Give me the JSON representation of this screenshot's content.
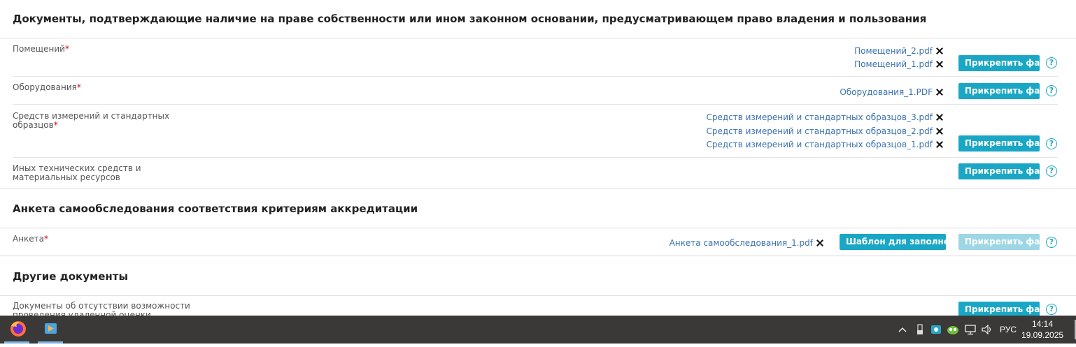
{
  "sections": [
    {
      "title": "Документы, подтверждающие наличие на праве собственности или ином законном основании, предусматривающем право владения и пользования"
    },
    {
      "title": "Анкета самообследования соответствия критериям аккредитации"
    },
    {
      "title": "Другие документы"
    }
  ],
  "rows": {
    "premises": {
      "label": "Помещений",
      "required": "*",
      "files": [
        "Помещений_2.pdf",
        "Помещений_1.pdf"
      ]
    },
    "equipment": {
      "label": "Оборудования",
      "required": "*",
      "files": [
        "Оборудования_1.PDF"
      ]
    },
    "measuring": {
      "label": "Средств измерений и стандартных образцов",
      "required": "*",
      "files": [
        "Средств измерений и стандартных образцов_3.pdf",
        "Средств измерений и стандартных образцов_2.pdf",
        "Средств измерений и стандартных образцов_1.pdf"
      ]
    },
    "other_tech": {
      "label": "Иных технических средств и материальных ресурсов"
    },
    "questionnaire": {
      "label": "Анкета",
      "required": "*",
      "files": [
        "Анкета самообследования_1.pdf"
      ],
      "template_button": "Шаблон для заполнения"
    },
    "absence_docs": {
      "label": "Документы об отсутствии возможности проведения удаленной оценки посредством"
    }
  },
  "buttons": {
    "attach_file": "Прикрепить файл"
  },
  "help_glyph": "?",
  "colors": {
    "accent": "#1aa7c5",
    "accent_disabled": "#9dd6e4",
    "link": "#3a72b0",
    "required": "#d0021b"
  },
  "taskbar": {
    "apps": [
      {
        "icon": "firefox-icon"
      },
      {
        "icon": "media-player-icon"
      }
    ],
    "tray": {
      "language": "РУС",
      "time": "14:14",
      "date": "19.09.2025"
    }
  }
}
